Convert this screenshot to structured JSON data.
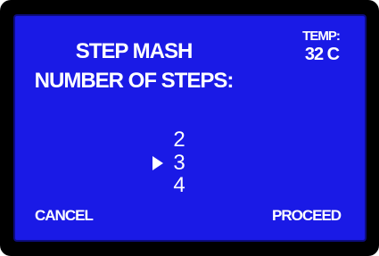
{
  "header": {
    "title_line1": "STEP MASH",
    "title_line2": "NUMBER OF STEPS:"
  },
  "temperature": {
    "label": "TEMP:",
    "value": "32 C"
  },
  "steps_selector": {
    "options": [
      "2",
      "3",
      "4"
    ],
    "selected": "3"
  },
  "softkeys": {
    "left": "CANCEL",
    "right": "PROCEED"
  },
  "colors": {
    "screen_background": "#1a1ae6",
    "text": "#ffffff",
    "bezel": "#000000"
  },
  "icons": {
    "selection_pointer": "triangle-right-icon"
  }
}
